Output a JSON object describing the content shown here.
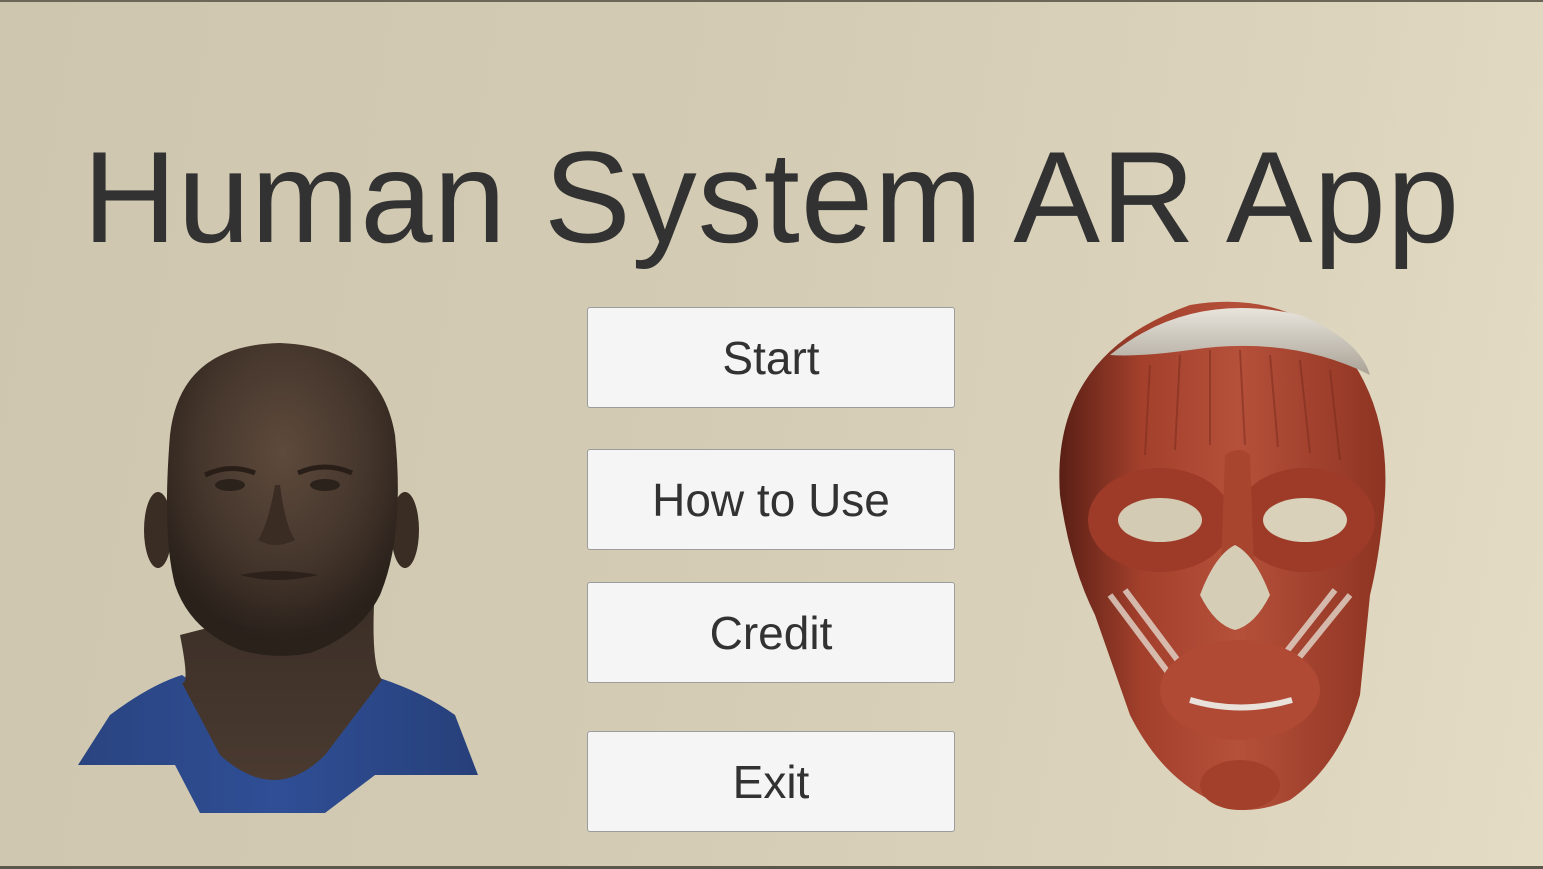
{
  "app": {
    "title": "Human System AR App"
  },
  "menu": {
    "start_label": "Start",
    "how_to_use_label": "How to Use",
    "credit_label": "Credit",
    "exit_label": "Exit"
  },
  "models": {
    "left": "human-head-3d-model",
    "right": "facial-muscles-3d-model"
  },
  "colors": {
    "background": "#d4ccb4",
    "title_text": "#323232",
    "button_bg": "#f5f5f5",
    "button_border": "#9d9d9d",
    "muscle": "#b0442f",
    "skin": "#4a3a30",
    "shirt": "#2d4a8a"
  }
}
